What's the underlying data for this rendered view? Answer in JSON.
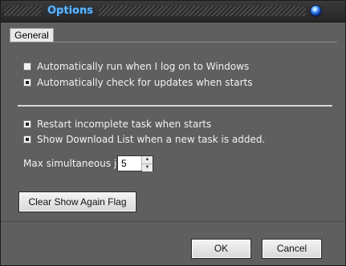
{
  "window": {
    "title": "Options"
  },
  "tabs": [
    {
      "label": "General"
    }
  ],
  "options": {
    "autorun": {
      "label": "Automatically run when I log on to Windows",
      "checked": false
    },
    "check_updates": {
      "label": "Automatically check for updates when starts",
      "checked": true
    },
    "restart_incomplete": {
      "label": "Restart incomplete task when starts",
      "checked": true
    },
    "show_download_list": {
      "label": "Show Download List when a new task is added.",
      "checked": true
    }
  },
  "max_jobs": {
    "label": "Max simultaneous jobs",
    "value": "5"
  },
  "buttons": {
    "clear_flag": "Clear Show Again Flag",
    "ok": "OK",
    "cancel": "Cancel"
  }
}
